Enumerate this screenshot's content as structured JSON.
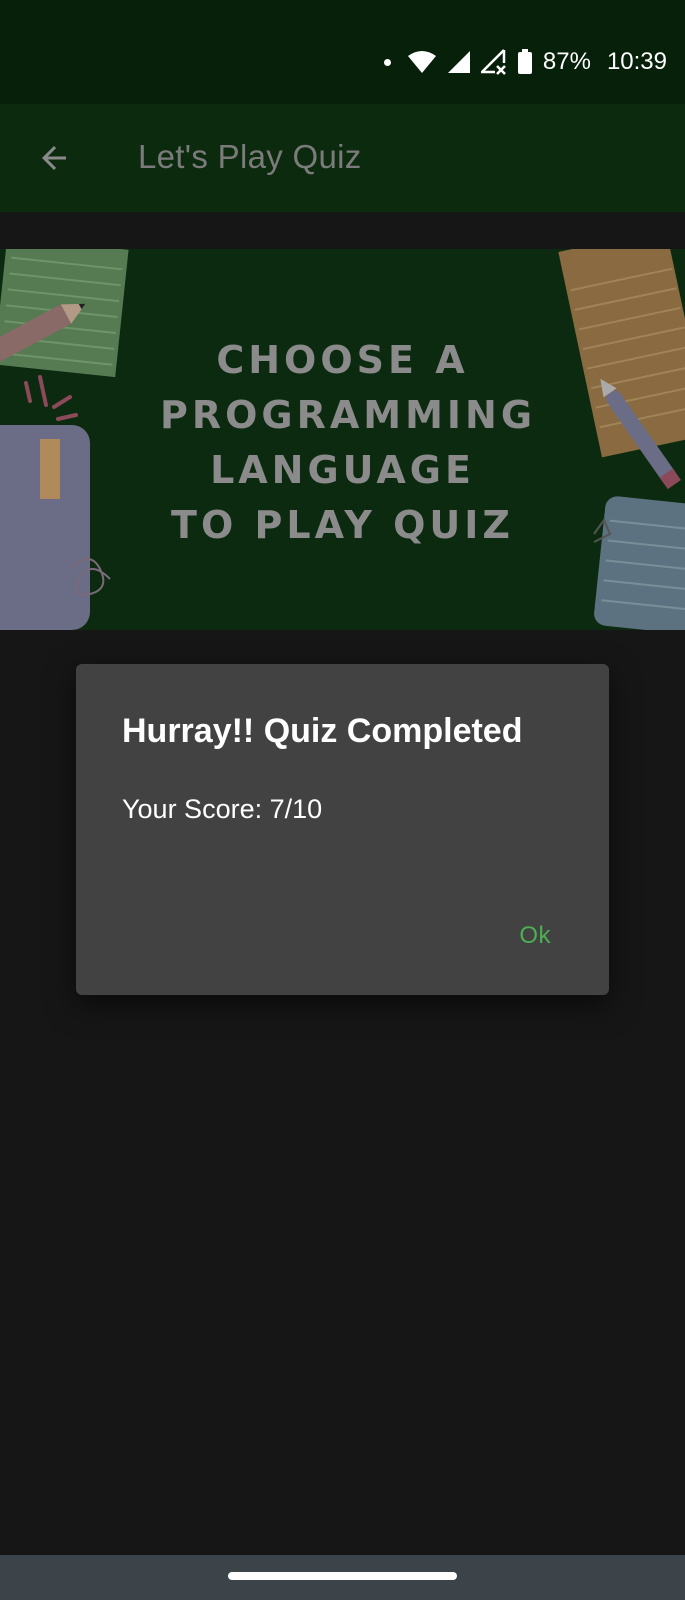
{
  "status_bar": {
    "battery_percent": "87%",
    "time": "10:39",
    "icons": [
      "dot-icon",
      "wifi-icon",
      "signal-icon",
      "signal-no-data-icon",
      "battery-icon"
    ]
  },
  "app_bar": {
    "title": "Let's Play Quiz",
    "back_icon": "arrow-back-icon"
  },
  "banner": {
    "lines": [
      "CHOOSE A",
      "PROGRAMMING",
      "LANGUAGE",
      "TO PLAY QUIZ"
    ]
  },
  "dialog": {
    "title": "Hurray!! Quiz Completed",
    "message": "Your Score: 7/10",
    "ok_label": "Ok"
  },
  "colors": {
    "status_bar": "#06200a",
    "app_bar": "#0b2a0e",
    "background": "#161616",
    "dialog": "#424242",
    "accent": "#4caf50"
  }
}
